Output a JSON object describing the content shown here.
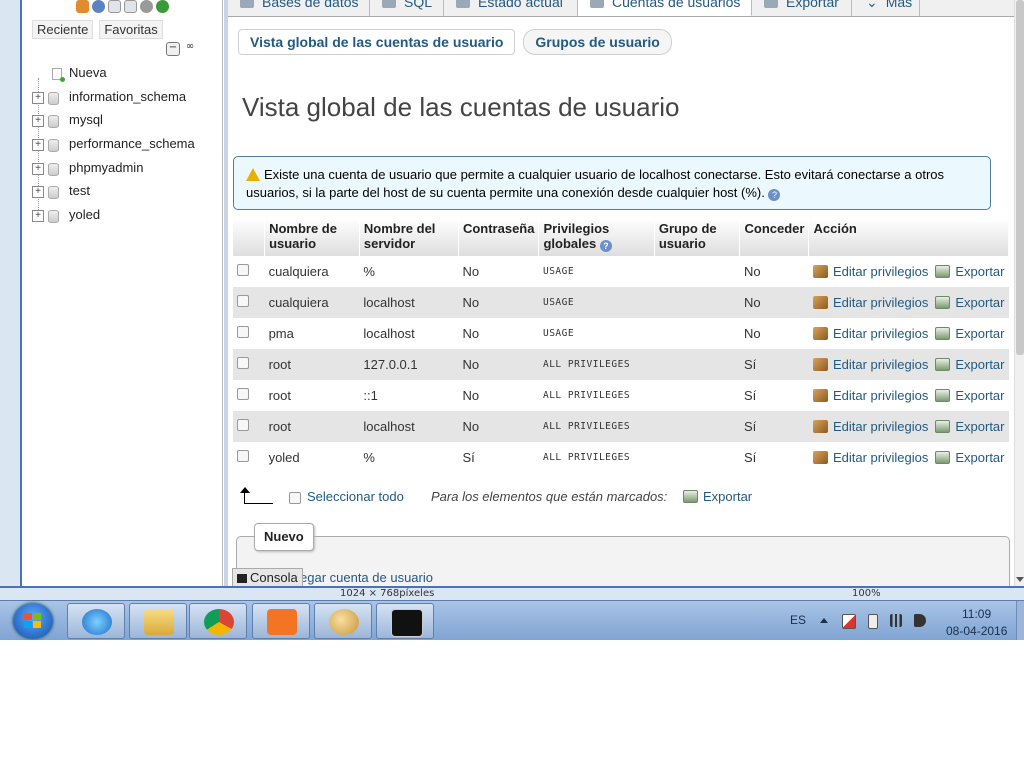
{
  "nav": {
    "links": [
      "Reciente",
      "Favoritas"
    ],
    "new_label": "Nueva",
    "databases": [
      "information_schema",
      "mysql",
      "performance_schema",
      "phpmyadmin",
      "test",
      "yoled"
    ]
  },
  "topmenu": {
    "tabs": [
      "Bases de datos",
      "SQL",
      "Estado actual",
      "Cuentas de usuarios",
      "Exportar",
      "Más"
    ]
  },
  "subtabs": [
    "Vista global de las cuentas de usuario",
    "Grupos de usuario"
  ],
  "page_title": "Vista global de las cuentas de usuario",
  "notice": "Existe una cuenta de usuario que permite a cualquier usuario de localhost conectarse. Esto evitará conectarse a otros usuarios, si la parte del host de su cuenta permite una conexión desde cualquier host (%).",
  "table": {
    "headers": [
      "Nombre de usuario",
      "Nombre del servidor",
      "Contraseña",
      "Privilegios globales",
      "Grupo de usuario",
      "Conceder",
      "Acción"
    ],
    "rows": [
      {
        "user": "cualquiera",
        "host": "%",
        "password": "No",
        "privileges": "USAGE",
        "group": "",
        "grant": "No"
      },
      {
        "user": "cualquiera",
        "host": "localhost",
        "password": "No",
        "privileges": "USAGE",
        "group": "",
        "grant": "No"
      },
      {
        "user": "pma",
        "host": "localhost",
        "password": "No",
        "privileges": "USAGE",
        "group": "",
        "grant": "No"
      },
      {
        "user": "root",
        "host": "127.0.0.1",
        "password": "No",
        "privileges": "ALL PRIVILEGES",
        "group": "",
        "grant": "Sí"
      },
      {
        "user": "root",
        "host": "::1",
        "password": "No",
        "privileges": "ALL PRIVILEGES",
        "group": "",
        "grant": "Sí"
      },
      {
        "user": "root",
        "host": "localhost",
        "password": "No",
        "privileges": "ALL PRIVILEGES",
        "group": "",
        "grant": "Sí"
      },
      {
        "user": "yoled",
        "host": "%",
        "password": "Sí",
        "privileges": "ALL PRIVILEGES",
        "group": "",
        "grant": "Sí"
      }
    ],
    "edit_label": "Editar privilegios",
    "export_label": "Exportar"
  },
  "footer": {
    "select_all": "Seleccionar todo",
    "marked_label": "Para los elementos que están marcados:",
    "export_label": "Exportar"
  },
  "new_section": {
    "legend": "Nuevo",
    "add_user": "egar cuenta de usuario"
  },
  "console_label": "Consola",
  "bottom_strip": {
    "left_text": "1024 × 768píxeles",
    "right_text": "100%"
  },
  "taskbar": {
    "lang": "ES",
    "time": "11:09",
    "date": "08-04-2016"
  },
  "colors": {
    "link": "#235a81",
    "no_password": "#dd0000",
    "anonymous_user": "#dd0000",
    "notice_bg": "#ebf8fd",
    "notice_border": "#567aa2"
  }
}
